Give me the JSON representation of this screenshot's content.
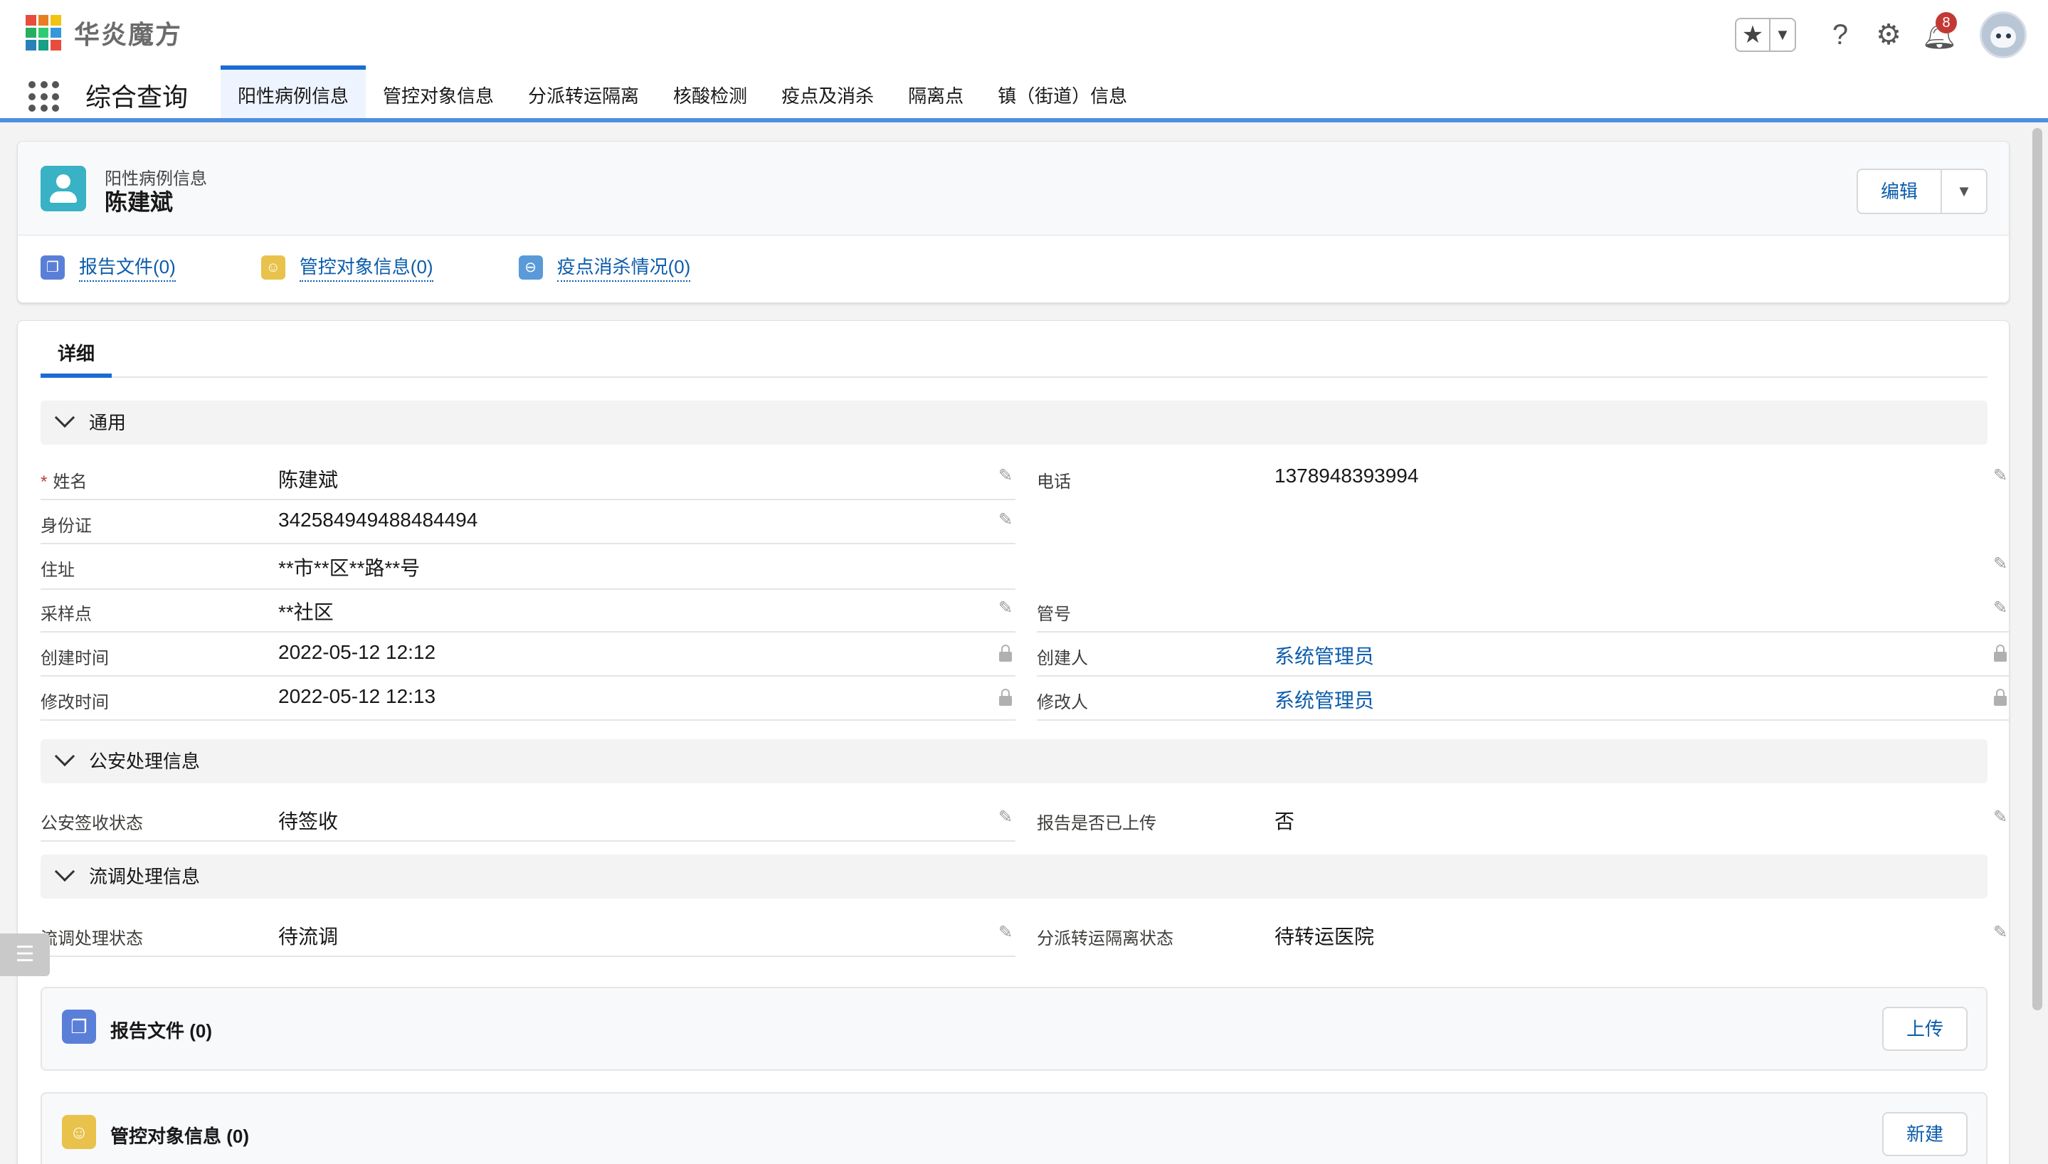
{
  "header": {
    "logo_text": "华炎魔方",
    "notification_count": "8",
    "icons": [
      "star-icon",
      "chevron-down-icon",
      "help-icon",
      "gear-icon",
      "bell-icon",
      "avatar"
    ]
  },
  "nav": {
    "app_name": "综合查询",
    "tabs": [
      {
        "label": "阳性病例信息",
        "active": true
      },
      {
        "label": "管控对象信息"
      },
      {
        "label": "分派转运隔离"
      },
      {
        "label": "核酸检测"
      },
      {
        "label": "疫点及消杀"
      },
      {
        "label": "隔离点"
      },
      {
        "label": "镇（街道）信息"
      }
    ]
  },
  "record": {
    "type": "阳性病例信息",
    "name": "陈建斌",
    "edit_label": "编辑"
  },
  "highlights": [
    {
      "label": "报告文件(0)",
      "color": "#5a7fd8",
      "icon": "file-icon"
    },
    {
      "label": "管控对象信息(0)",
      "color": "#e8c24a",
      "icon": "people-icon"
    },
    {
      "label": "疫点消杀情况(0)",
      "color": "#5a9ad8",
      "icon": "minus-circle-icon"
    }
  ],
  "detail": {
    "tab_label": "详细",
    "sections": {
      "general": "通用",
      "police": "公安处理信息",
      "epi": "流调处理信息"
    },
    "fields": {
      "name": {
        "label": "姓名",
        "value": "陈建斌"
      },
      "phone": {
        "label": "电话",
        "value": "1378948393994"
      },
      "idcard": {
        "label": "身份证",
        "value": "342584949488484494"
      },
      "address": {
        "label": "住址",
        "value": " **市**区**路**号"
      },
      "sample_point": {
        "label": "采样点",
        "value": "**社区"
      },
      "tube_no": {
        "label": "管号",
        "value": ""
      },
      "created_time": {
        "label": "创建时间",
        "value": "2022-05-12 12:12"
      },
      "creator": {
        "label": "创建人",
        "value": "系统管理员"
      },
      "modified_time": {
        "label": "修改时间",
        "value": "2022-05-12 12:13"
      },
      "modifier": {
        "label": "修改人",
        "value": "系统管理员"
      },
      "police_status": {
        "label": "公安签收状态",
        "value": "待签收"
      },
      "report_uploaded": {
        "label": "报告是否已上传",
        "value": "否"
      },
      "epi_status": {
        "label": "流调处理状态",
        "value": "待流调"
      },
      "transfer_status": {
        "label": "分派转运隔离状态",
        "value": "待转运医院"
      }
    }
  },
  "related": [
    {
      "title": "报告文件 (0)",
      "button": "上传",
      "color": "#5a7fd8",
      "icon": "file-icon"
    },
    {
      "title": "管控对象信息 (0)",
      "button": "新建",
      "color": "#e8c24a",
      "icon": "people-icon"
    }
  ]
}
